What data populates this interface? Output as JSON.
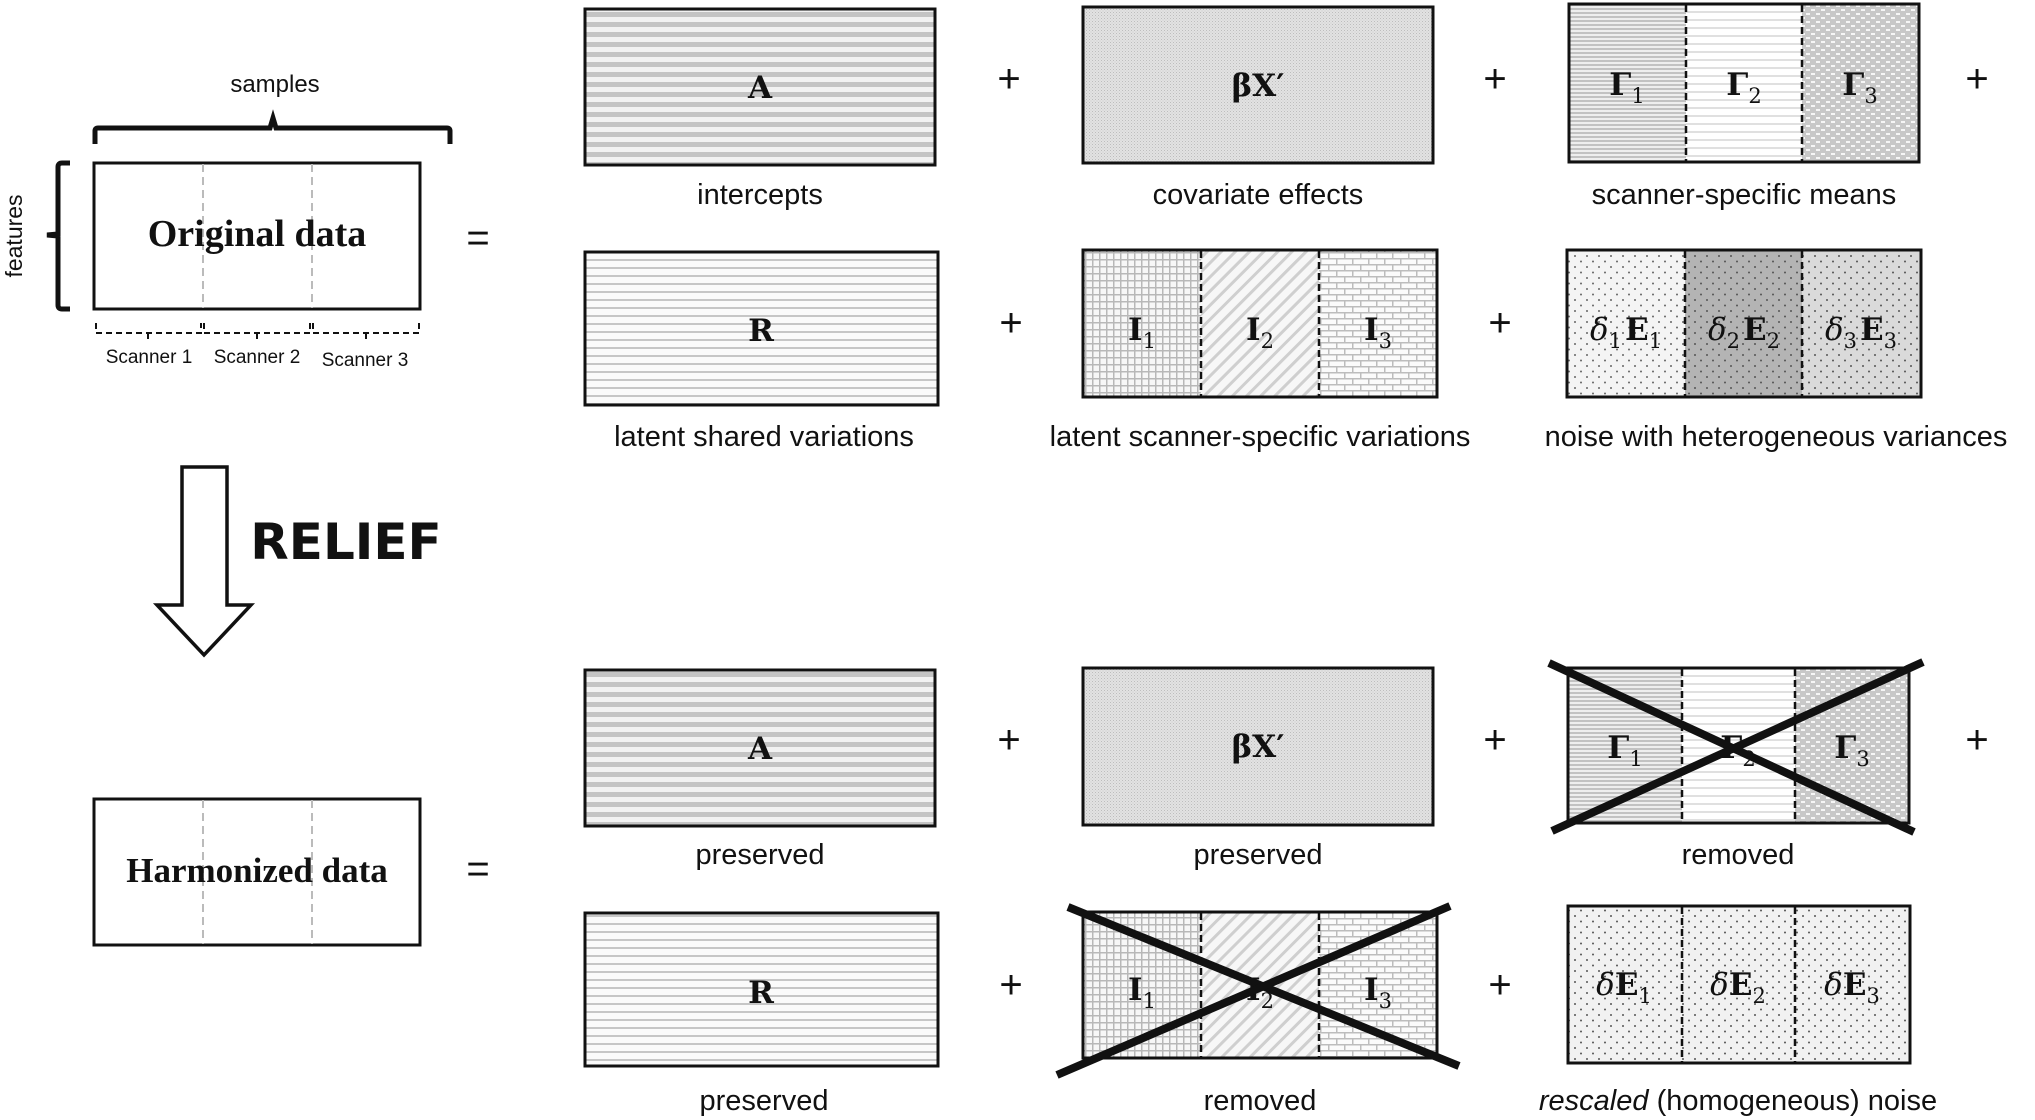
{
  "figure": {
    "original": {
      "title": "Original data",
      "samples_label": "samples",
      "features_label": "features",
      "scanners": [
        "Scanner 1",
        "Scanner 2",
        "Scanner 3"
      ]
    },
    "harmonized": {
      "title": "Harmonized data"
    },
    "method_label": "RELIEF",
    "operators": {
      "equals": "=",
      "plus": "+"
    },
    "top": {
      "intercepts": {
        "symbol": "A",
        "caption": "intercepts"
      },
      "covariates": {
        "symbol": "βX′",
        "caption": "covariate effects"
      },
      "means": {
        "symbol": "Γ",
        "subs": [
          "1",
          "2",
          "3"
        ],
        "caption": "scanner-specific means"
      },
      "shared": {
        "symbol": "R",
        "caption": "latent shared variations"
      },
      "specific": {
        "symbol": "I",
        "subs": [
          "1",
          "2",
          "3"
        ],
        "caption": "latent scanner-specific variations"
      },
      "noise": {
        "delta": "δ",
        "symbol": "E",
        "subs": [
          "1",
          "2",
          "3"
        ],
        "caption": "noise with heterogeneous variances"
      }
    },
    "bottom": {
      "intercepts": {
        "symbol": "A",
        "caption": "preserved"
      },
      "covariates": {
        "symbol": "βX′",
        "caption": "preserved"
      },
      "means": {
        "symbol": "Γ",
        "subs": [
          "1",
          "2",
          "3"
        ],
        "caption": "removed"
      },
      "shared": {
        "symbol": "R",
        "caption": "preserved"
      },
      "specific": {
        "symbol": "I",
        "subs": [
          "1",
          "2",
          "3"
        ],
        "caption": "removed"
      },
      "noise": {
        "delta": "δ",
        "symbol": "E",
        "subs": [
          "1",
          "2",
          "3"
        ],
        "caption_italic": "rescaled",
        "caption_rest": " (homogeneous) noise"
      }
    },
    "colors": {
      "stroke": "#111111",
      "divider_gray": "#bbbbbb",
      "noise1": "#f4f4f4",
      "noise2": "#b4b4b4",
      "noise3": "#dadada",
      "noise_homogeneous": "#f1f1f1"
    }
  }
}
